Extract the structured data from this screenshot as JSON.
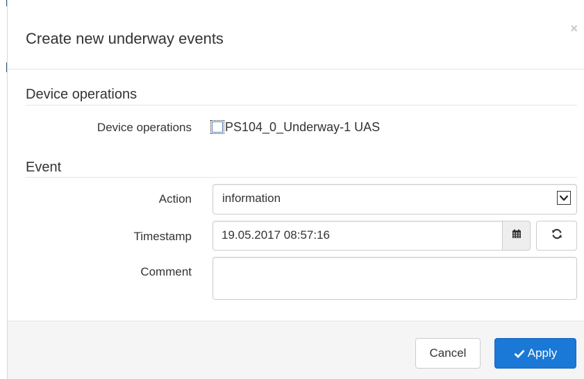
{
  "modal": {
    "title": "Create new underway events",
    "close_symbol": "×"
  },
  "device_section": {
    "title": "Device operations",
    "field_label": "Device operations",
    "checkbox": {
      "label": "PS104_0_Underway-1 UAS",
      "checked": false
    }
  },
  "event_section": {
    "title": "Event",
    "action": {
      "label": "Action",
      "selected": "information",
      "icon": "chevron-down-icon"
    },
    "timestamp": {
      "label": "Timestamp",
      "value": "19.05.2017 08:57:16",
      "calendar_icon": "calendar-icon",
      "refresh_icon": "refresh-icon"
    },
    "comment": {
      "label": "Comment",
      "value": ""
    }
  },
  "footer": {
    "cancel_label": "Cancel",
    "apply_label": "Apply",
    "apply_icon": "check-icon"
  },
  "colors": {
    "primary": "#1a78d6",
    "border": "#cccccc",
    "footer_bg": "#f5f5f5"
  }
}
